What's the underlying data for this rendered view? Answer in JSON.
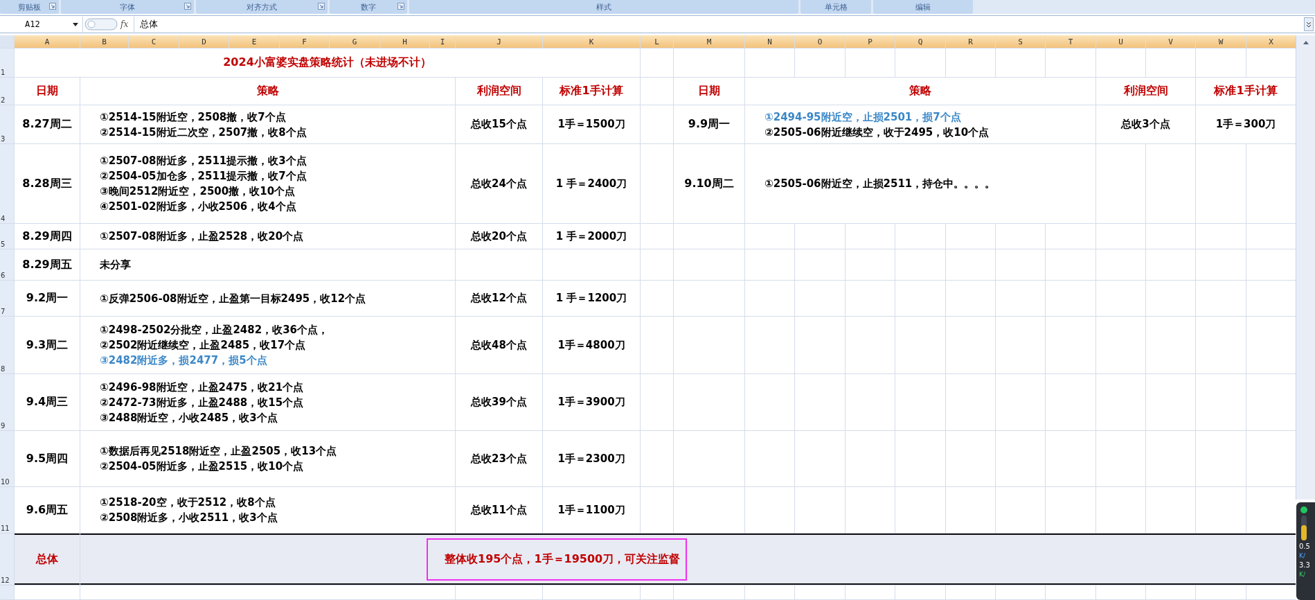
{
  "ribbon_groups": [
    {
      "label": "剪贴板",
      "launcher": true
    },
    {
      "label": "字体",
      "launcher": true
    },
    {
      "label": "对齐方式",
      "launcher": true
    },
    {
      "label": "数字",
      "launcher": true
    },
    {
      "label": "样式",
      "launcher": false
    },
    {
      "label": "单元格",
      "launcher": false
    },
    {
      "label": "编辑",
      "launcher": false
    }
  ],
  "formula_bar": {
    "name_box": "A12",
    "fx": "fx",
    "formula": "总体"
  },
  "columns": [
    "A",
    "B",
    "C",
    "D",
    "E",
    "F",
    "G",
    "H",
    "I",
    "J",
    "K",
    "L",
    "M",
    "N",
    "O",
    "P",
    "Q",
    "R",
    "S",
    "T",
    "U",
    "V",
    "W",
    "X"
  ],
  "row_numbers": [
    "1",
    "2",
    "3",
    "4",
    "5",
    "6",
    "7",
    "8",
    "9",
    "10",
    "11",
    "12"
  ],
  "title": "2024小富婆实盘策略统计（未进场不计）",
  "headers": {
    "left": [
      "日期",
      "策略",
      "利润空间",
      "标准1手计算"
    ],
    "right": [
      "日期",
      "策略",
      "利润空间",
      "标准1手计算"
    ]
  },
  "left_rows": [
    {
      "date": "8.27周二",
      "lines": [
        {
          "text": "①2514-15附近空，2508撤，收7个点",
          "loss": false
        },
        {
          "text": "②2514-15附近二次空，2507撤，收8个点",
          "loss": false
        }
      ],
      "total": "总收15个点",
      "per_lot": "1手＝1500刀"
    },
    {
      "date": "8.28周三",
      "lines": [
        {
          "text": "①2507-08附近多，2511提示撤，收3个点",
          "loss": false
        },
        {
          "text": "②2504-05加仓多，2511提示撤，收7个点",
          "loss": false
        },
        {
          "text": "③晚间2512附近空，2500撤，收10个点",
          "loss": false
        },
        {
          "text": "④2501-02附近多，小收2506，收4个点",
          "loss": false
        }
      ],
      "total": "总收24个点",
      "per_lot": "1 手＝2400刀"
    },
    {
      "date": "8.29周四",
      "lines": [
        {
          "text": "①2507-08附近多，止盈2528，收20个点",
          "loss": false
        }
      ],
      "total": "总收20个点",
      "per_lot": "1 手＝2000刀"
    },
    {
      "date": "8.29周五",
      "lines": [
        {
          "text": "未分享",
          "loss": false
        }
      ]
    },
    {
      "date": "9.2周一",
      "lines": [
        {
          "text": "①反弹2506-08附近空，止盈第一目标2495，收12个点",
          "loss": false
        }
      ],
      "total": "总收12个点",
      "per_lot": "1 手＝1200刀"
    },
    {
      "date": "9.3周二",
      "lines": [
        {
          "text": "①2498-2502分批空，止盈2482，收36个点，",
          "loss": false
        },
        {
          "text": "②2502附近继续空，止盈2485，收17个点",
          "loss": false
        },
        {
          "text": "③2482附近多，损2477，损5个点",
          "loss": true
        }
      ],
      "total": "总收48个点",
      "per_lot": "1手＝4800刀"
    },
    {
      "date": "9.4周三",
      "lines": [
        {
          "text": "①2496-98附近空，止盈2475，收21个点",
          "loss": false
        },
        {
          "text": "②2472-73附近多，止盈2488，收15个点",
          "loss": false
        },
        {
          "text": "③2488附近空，小收2485，收3个点",
          "loss": false
        }
      ],
      "total": "总收39个点",
      "per_lot": "1手＝3900刀"
    },
    {
      "date": "9.5周四",
      "lines": [
        {
          "text": "①数据后再见2518附近空，止盈2505，收13个点",
          "loss": false
        },
        {
          "text": "②2504-05附近多，止盈2515，收10个点",
          "loss": false
        }
      ],
      "total": "总收23个点",
      "per_lot": "1手＝2300刀"
    },
    {
      "date": "9.6周五",
      "lines": [
        {
          "text": "①2518-20空，收于2512，收8个点",
          "loss": false
        },
        {
          "text": "②2508附近多，小收2511，收3个点",
          "loss": false
        }
      ],
      "total": "总收11个点",
      "per_lot": "1手＝1100刀"
    }
  ],
  "right_rows": [
    {
      "date": "9.9周一",
      "lines": [
        {
          "text": "①2494-95附近空，止损2501，损7个点",
          "loss": true
        },
        {
          "text": "②2505-06附近继续空，收于2495，收10个点",
          "loss": false
        }
      ],
      "total": "总收3个点",
      "per_lot": "1手＝300刀"
    },
    {
      "date": "9.10周二",
      "lines": [
        {
          "text": "①2505-06附近空，止损2511，持仓中。。。。",
          "loss": false
        }
      ]
    }
  ],
  "total": {
    "label": "总体",
    "summary": "整体收195个点，1手＝19500刀，可关注监督"
  },
  "net_monitor": {
    "upload": "0.5",
    "upload_unit": "K/",
    "download": "3.3",
    "download_unit": "K/"
  }
}
